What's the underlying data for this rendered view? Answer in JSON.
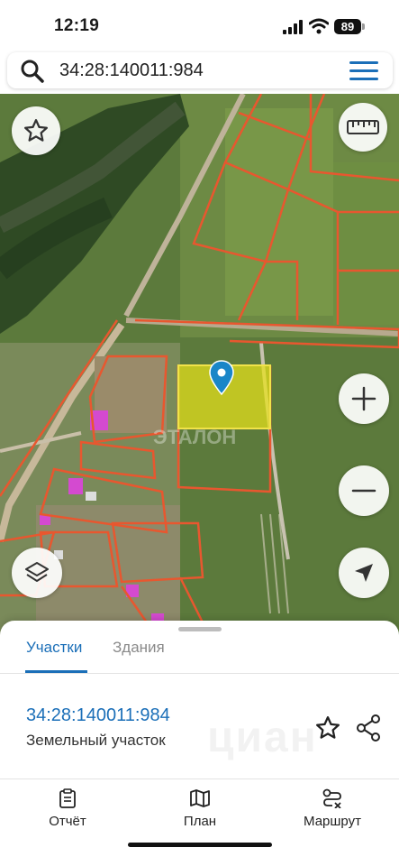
{
  "status_bar": {
    "time": "12:19",
    "battery": "89",
    "signal_icon": "cellular-signal-icon",
    "wifi_icon": "wifi-icon"
  },
  "search": {
    "query": "34:28:140011:984",
    "search_icon": "search-icon",
    "menu_icon": "hamburger-menu-icon"
  },
  "map": {
    "watermark": "ЭТАЛОН",
    "highlight_color": "#e8e21a",
    "boundary_color": "#e8572f",
    "pin_color": "#1a86c8",
    "buttons": {
      "favorite_icon": "star-icon",
      "ruler_icon": "ruler-icon",
      "zoom_in_icon": "plus-icon",
      "zoom_out_icon": "minus-icon",
      "layers_icon": "layers-icon",
      "locate_icon": "navigation-arrow-icon"
    }
  },
  "sheet": {
    "tabs": [
      {
        "label": "Участки",
        "active": true
      },
      {
        "label": "Здания",
        "active": false
      }
    ],
    "parcel": {
      "id": "34:28:140011:984",
      "type": "Земельный участок"
    },
    "watermark": "циан",
    "actions": {
      "favorite_icon": "star-outline-icon",
      "share_icon": "share-icon"
    }
  },
  "bottom_nav": [
    {
      "label": "Отчёт",
      "icon": "report-icon"
    },
    {
      "label": "План",
      "icon": "map-plan-icon"
    },
    {
      "label": "Маршрут",
      "icon": "route-icon"
    }
  ],
  "colors": {
    "accent": "#1b6fb8"
  }
}
